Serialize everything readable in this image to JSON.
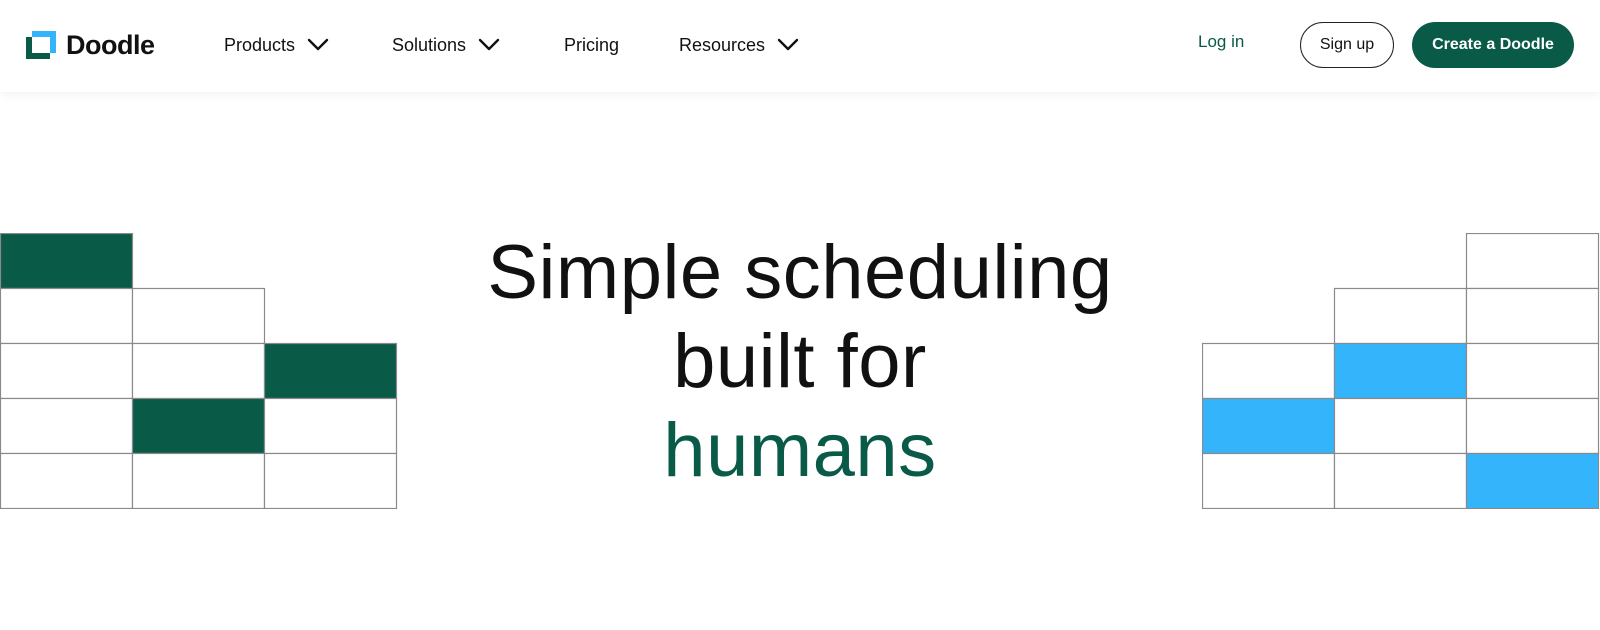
{
  "brand": {
    "name": "Doodle",
    "colors": {
      "green": "#0a5a48",
      "blue": "#33b4fb",
      "text": "#111111"
    }
  },
  "nav": {
    "items": [
      {
        "label": "Products",
        "has_dropdown": true,
        "icon": "chevron-down-icon"
      },
      {
        "label": "Solutions",
        "has_dropdown": true,
        "icon": "chevron-down-icon"
      },
      {
        "label": "Pricing",
        "has_dropdown": false
      },
      {
        "label": "Resources",
        "has_dropdown": true,
        "icon": "chevron-down-icon"
      }
    ]
  },
  "actions": {
    "login": "Log in",
    "signup": "Sign up",
    "create": "Create a Doodle"
  },
  "hero": {
    "line1": "Simple scheduling",
    "line2": "built for",
    "line3": "humans"
  },
  "decor": {
    "left_grid": {
      "fill_color": "#0a5a48",
      "rows": [
        [
          1
        ],
        [
          0,
          0
        ],
        [
          0,
          0,
          1
        ],
        [
          0,
          1,
          0
        ],
        [
          0,
          0,
          0
        ]
      ]
    },
    "right_grid": {
      "fill_color": "#33b4fb",
      "rows": [
        [
          0
        ],
        [
          0,
          0
        ],
        [
          0,
          1,
          0
        ],
        [
          1,
          0,
          0
        ],
        [
          0,
          0,
          1
        ]
      ]
    }
  }
}
